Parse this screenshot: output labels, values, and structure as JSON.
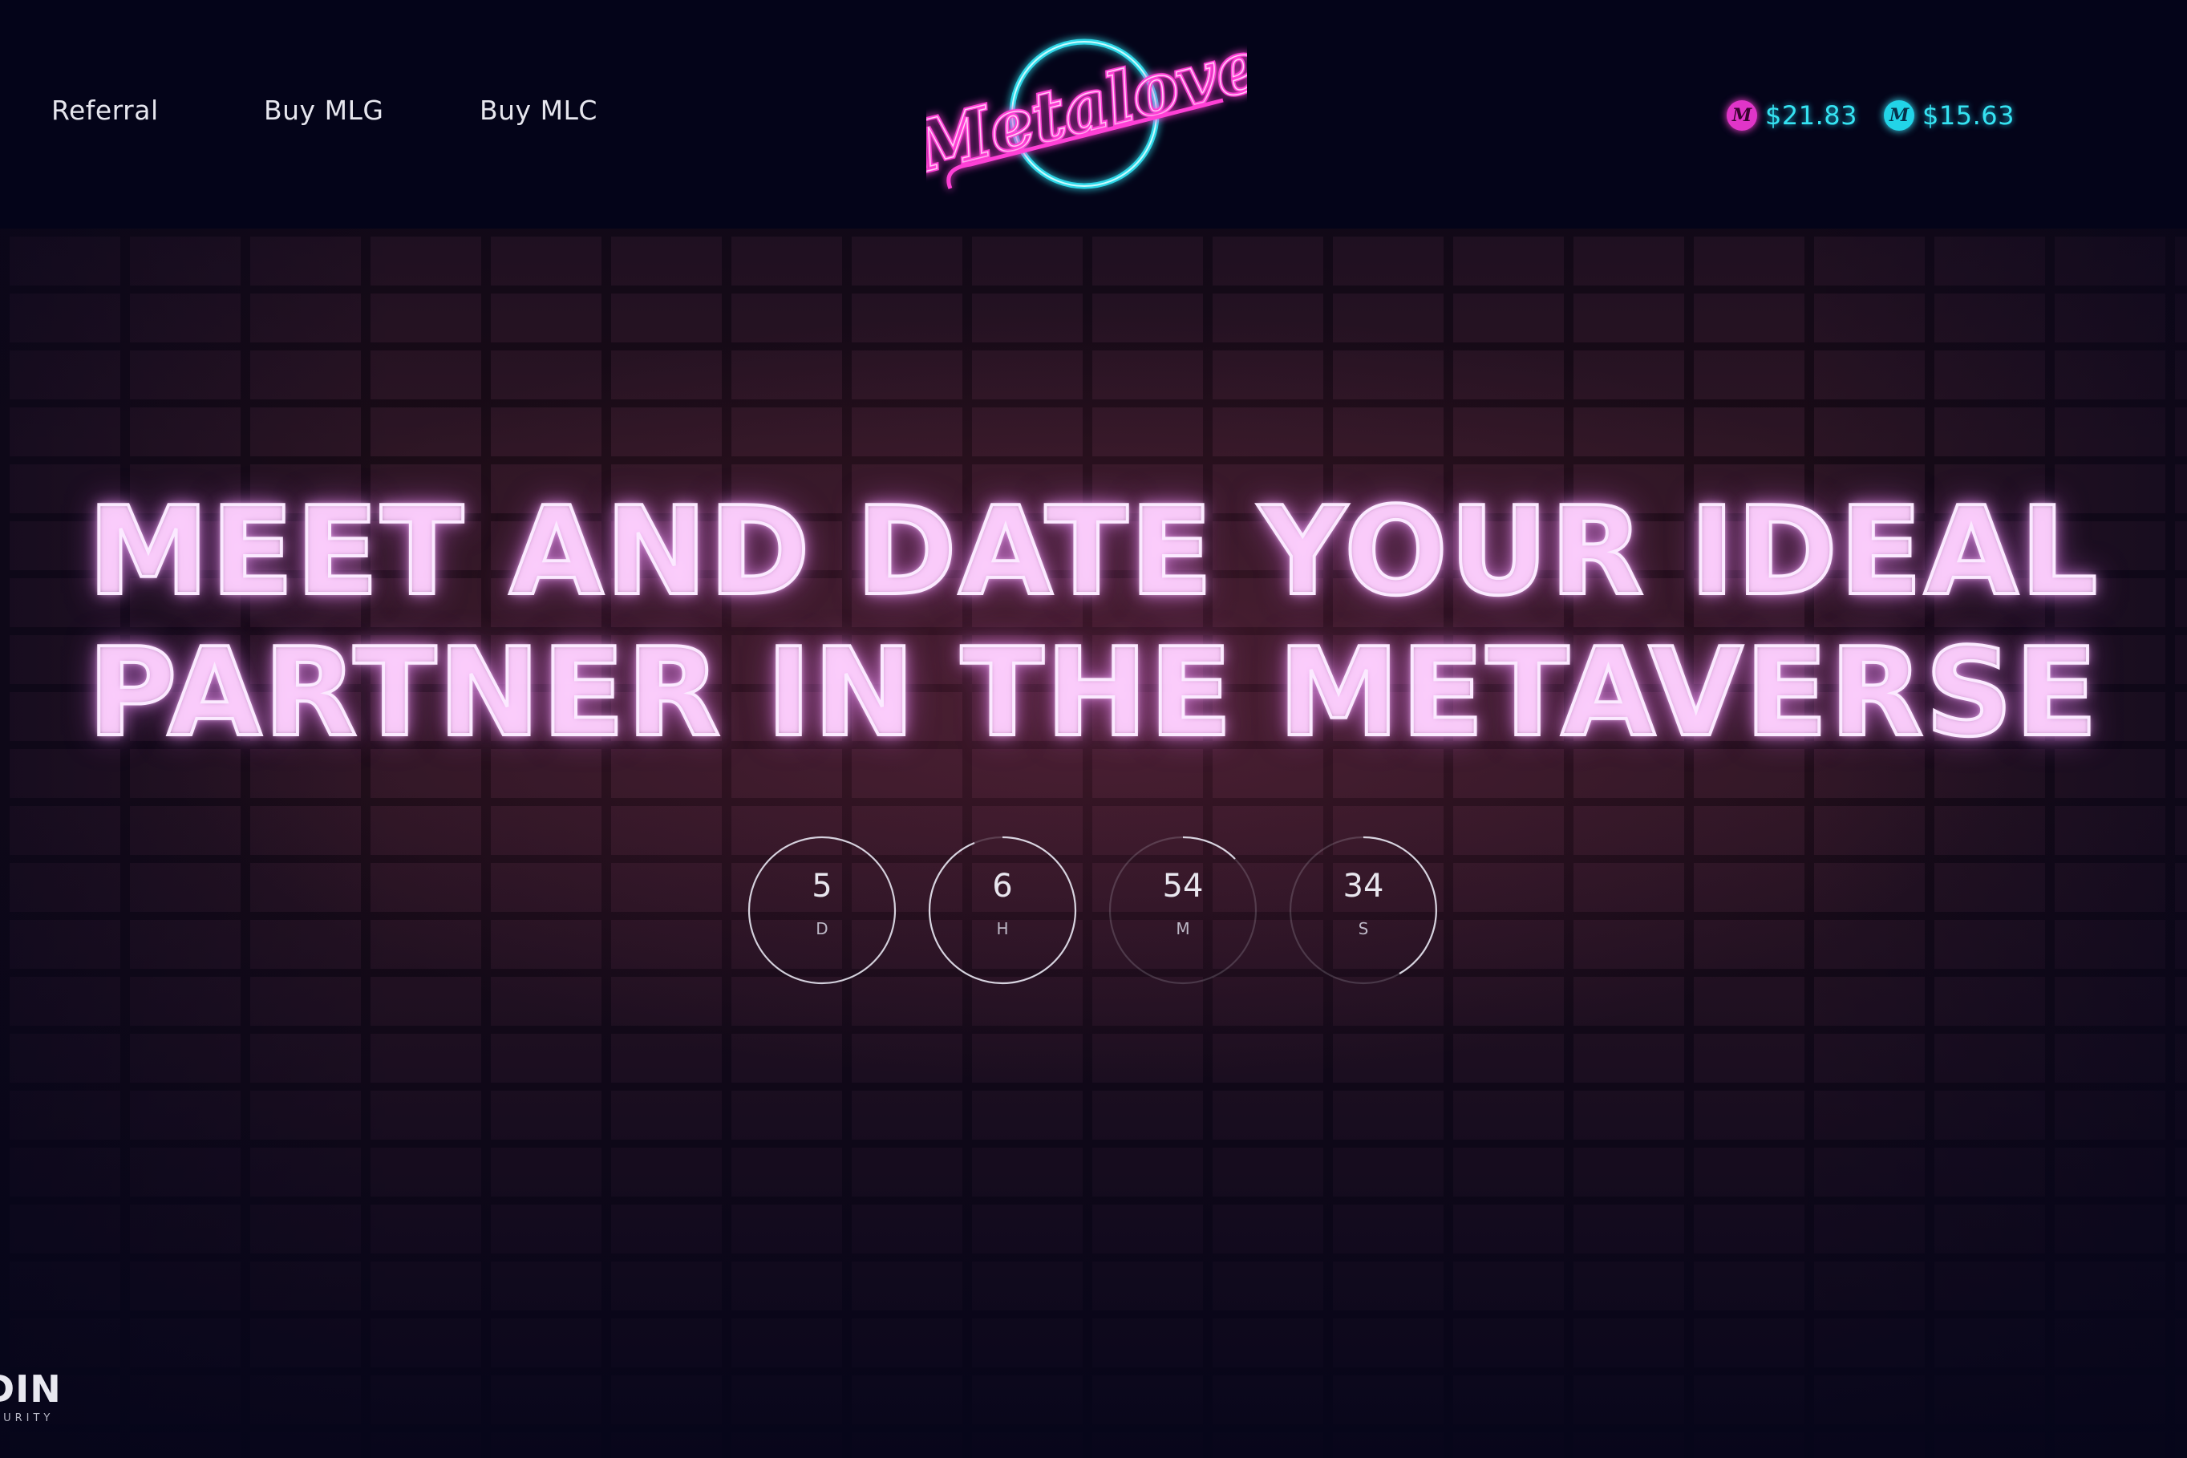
{
  "header": {
    "nav": [
      {
        "label": "Referral"
      },
      {
        "label": "Buy MLG"
      },
      {
        "label": "Buy MLC"
      }
    ],
    "logo_text": "Metalove",
    "prices": [
      {
        "token_icon": "mlg-token-icon",
        "icon_glyph": "M",
        "value": "$21.83"
      },
      {
        "token_icon": "mlc-token-icon",
        "icon_glyph": "M",
        "value": "$15.63"
      }
    ]
  },
  "hero": {
    "headline_line1": "MEET AND DATE YOUR IDEAL",
    "headline_line2": "PARTNER IN THE METAVERSE"
  },
  "countdown": {
    "days": {
      "value": "5",
      "label": "D"
    },
    "hours": {
      "value": "6",
      "label": "H"
    },
    "minutes": {
      "value": "54",
      "label": "M"
    },
    "seconds": {
      "value": "34",
      "label": "S"
    }
  },
  "footer_badge": {
    "main": "DIN",
    "sub": "CURITY"
  },
  "colors": {
    "background": "#05051a",
    "neon_pink": "#ff3fd6",
    "neon_cyan": "#2fe2f2",
    "headline_glow": "#f4b8ff"
  }
}
